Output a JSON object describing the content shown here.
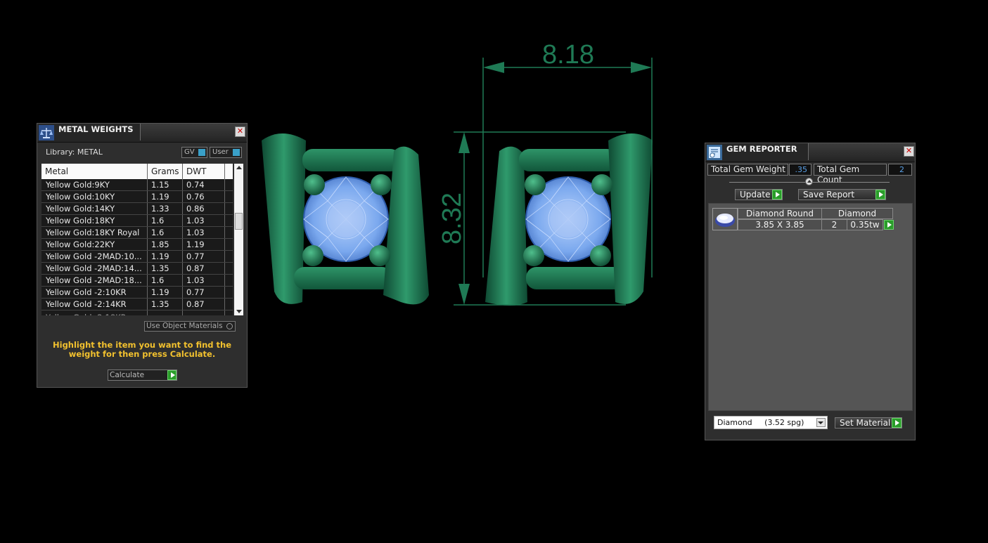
{
  "metal_panel": {
    "title": "METAL WEIGHTS",
    "library_label": "Library: METAL",
    "gv_label": "GV",
    "user_label": "User",
    "columns": [
      "Metal",
      "Grams",
      "DWT"
    ],
    "rows": [
      {
        "metal": "Yellow Gold:9KY",
        "grams": "1.15",
        "dwt": "0.74"
      },
      {
        "metal": "Yellow Gold:10KY",
        "grams": "1.19",
        "dwt": "0.76"
      },
      {
        "metal": "Yellow Gold:14KY",
        "grams": "1.33",
        "dwt": "0.86"
      },
      {
        "metal": "Yellow Gold:18KY",
        "grams": "1.6",
        "dwt": "1.03"
      },
      {
        "metal": "Yellow Gold:18KY Royal",
        "grams": "1.6",
        "dwt": "1.03"
      },
      {
        "metal": "Yellow Gold:22KY",
        "grams": "1.85",
        "dwt": "1.19"
      },
      {
        "metal": "Yellow Gold -2MAD:10...",
        "grams": "1.19",
        "dwt": "0.77"
      },
      {
        "metal": "Yellow Gold -2MAD:14...",
        "grams": "1.35",
        "dwt": "0.87"
      },
      {
        "metal": "Yellow Gold -2MAD:18...",
        "grams": "1.6",
        "dwt": "1.03"
      },
      {
        "metal": "Yellow Gold -2:10KR",
        "grams": "1.19",
        "dwt": "0.77"
      },
      {
        "metal": "Yellow Gold -2:14KR",
        "grams": "1.35",
        "dwt": "0.87"
      }
    ],
    "use_object_materials": "Use Object Materials",
    "hint": "Highlight the item you want to find the weight for then press Calculate.",
    "calculate_label": "Calculate"
  },
  "dimensions": {
    "width": "8.18",
    "height": "8.32"
  },
  "gem_panel": {
    "title": "GEM REPORTER",
    "total_weight_label": "Total Gem Weight",
    "total_weight_value": ".35",
    "total_count_label": "Total Gem Count",
    "total_count_value": "2",
    "update_label": "Update",
    "save_report_label": "Save Report",
    "gem_row": {
      "shape": "Diamond Round",
      "material": "Diamond",
      "size": "3.85 X 3.85",
      "count": "2",
      "weight": "0.35tw"
    },
    "material_select": "Diamond     (3.52 spg)",
    "set_material_label": "Set Material"
  },
  "colors": {
    "metal_green": "#1f7a55",
    "gem_blue": "#7aa8ee",
    "hint_yellow": "#f2c12e"
  }
}
